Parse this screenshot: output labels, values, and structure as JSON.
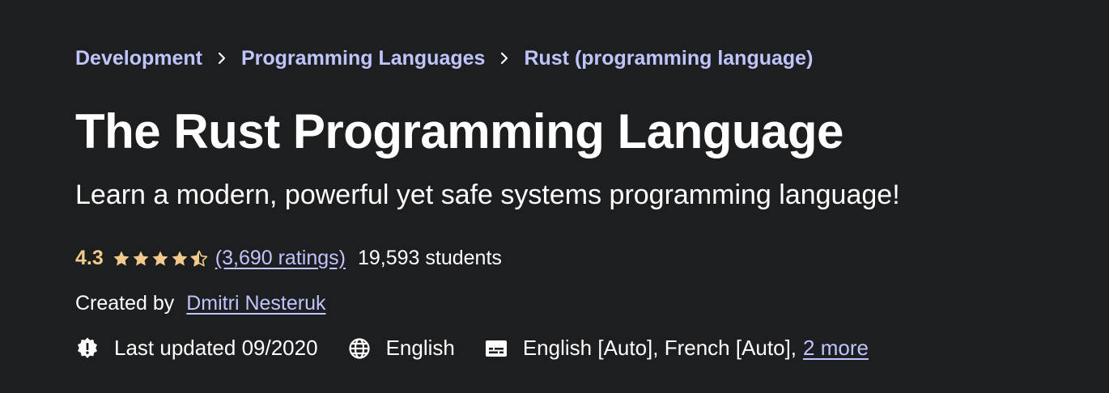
{
  "breadcrumb": {
    "items": [
      {
        "label": "Development"
      },
      {
        "label": "Programming Languages"
      },
      {
        "label": "Rust (programming language)"
      }
    ]
  },
  "course": {
    "title": "The Rust Programming Language",
    "subtitle": "Learn a modern, powerful yet safe systems programming language!"
  },
  "rating": {
    "value": "4.3",
    "stars": 4.3,
    "ratings_count_label": "(3,690 ratings)",
    "students_label": "19,593 students"
  },
  "creator": {
    "prefix": "Created by",
    "name": "Dmitri Nesteruk"
  },
  "meta": {
    "last_updated": "Last updated 09/2020",
    "language": "English",
    "captions": "English [Auto], French [Auto],",
    "more_link": "2 more"
  },
  "colors": {
    "background": "#1d1e20",
    "link": "#c0c4fc",
    "rating": "#f3ca8c",
    "text": "#ffffff"
  },
  "icons": {
    "breadcrumb_separator": "chevron-right-icon",
    "star_full": "star-icon",
    "star_half": "star-half-icon",
    "updated": "new-badge-icon",
    "language": "globe-icon",
    "captions": "closed-captions-icon"
  }
}
